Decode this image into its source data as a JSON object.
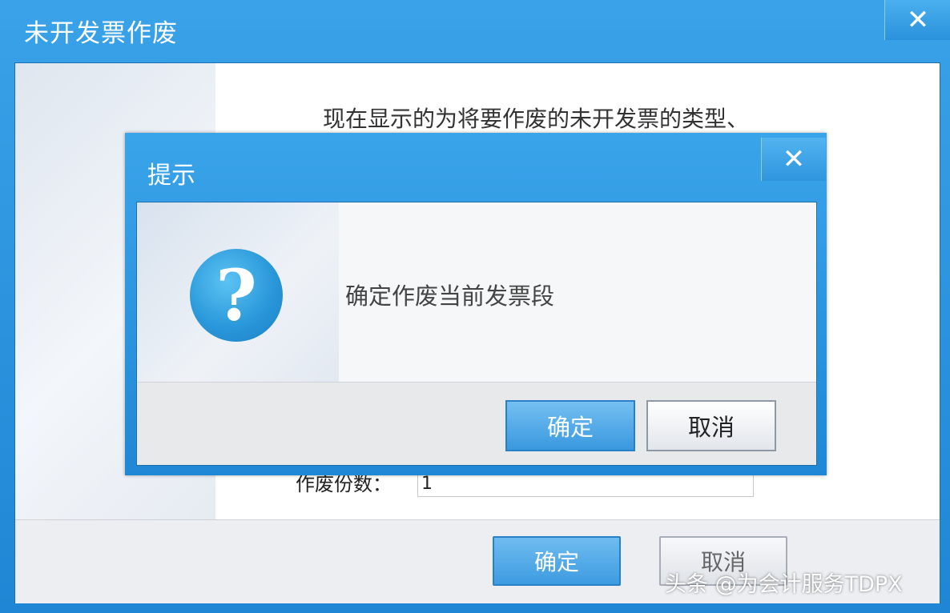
{
  "outer_window": {
    "title": "未开发票作废",
    "close_icon": "close-icon",
    "description": "现在显示的为将要作废的未开发票的类型、",
    "field_label": "作废份数：",
    "field_value": "1",
    "ok_label": "确定",
    "cancel_label": "取消"
  },
  "dialog": {
    "title": "提示",
    "close_icon": "close-icon",
    "icon": "question-icon",
    "icon_glyph": "?",
    "message": "确定作废当前发票段",
    "ok_label": "确定",
    "cancel_label": "取消"
  },
  "watermark": "头条 @为会计服务TDPX",
  "colors": {
    "titlebar_blue": "#2b93db",
    "primary_button": "#3d9be0",
    "icon_blue": "#2a98da"
  }
}
